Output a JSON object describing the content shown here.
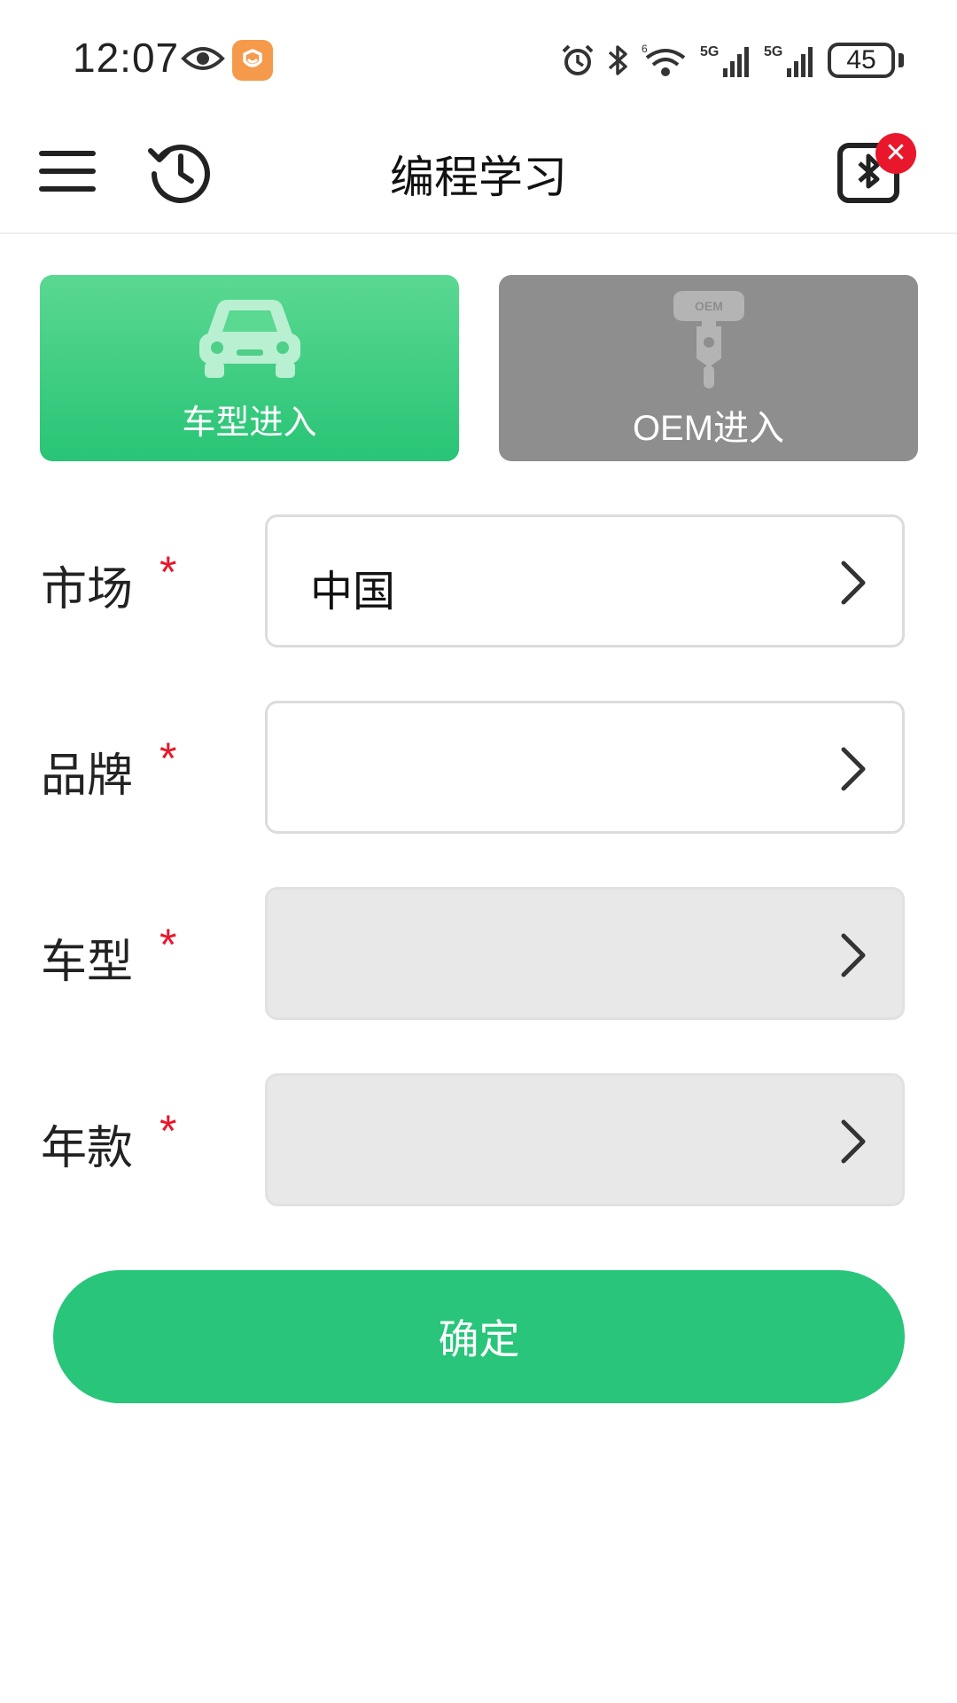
{
  "status_bar": {
    "time": "12:07",
    "battery": "45",
    "signal1": "5G",
    "signal2": "5G",
    "wifi_badge": "6"
  },
  "app_bar": {
    "title": "编程学习",
    "badge": "✕"
  },
  "tiles": {
    "car": {
      "label": "车型进入"
    },
    "oem": {
      "label": "OEM进入",
      "key_text": "OEM"
    }
  },
  "form": {
    "rows": [
      {
        "label": "市场",
        "required": "*",
        "value": "中国",
        "enabled": true
      },
      {
        "label": "品牌",
        "required": "*",
        "value": "",
        "enabled": true
      },
      {
        "label": "车型",
        "required": "*",
        "value": "",
        "enabled": false
      },
      {
        "label": "年款",
        "required": "*",
        "value": "",
        "enabled": false
      }
    ],
    "confirm_label": "确定"
  },
  "colors": {
    "accent_green": "#28c57a",
    "oem_gray": "#8e8e8e",
    "required_red": "#e8172b",
    "disabled_field": "#e8e8e8"
  }
}
